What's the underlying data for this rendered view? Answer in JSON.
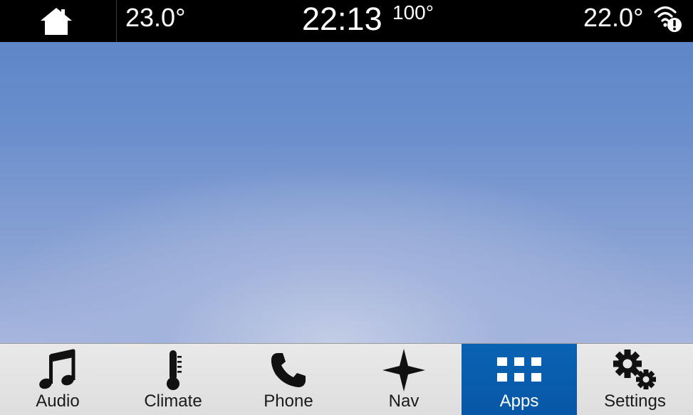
{
  "status_bar": {
    "driver_temp": "23.0°",
    "clock": "22:13",
    "outside_temp": "100°",
    "passenger_temp": "22.0°"
  },
  "nav": {
    "items": [
      {
        "label": "Audio",
        "icon": "music-note-icon",
        "active": false
      },
      {
        "label": "Climate",
        "icon": "thermometer-icon",
        "active": false
      },
      {
        "label": "Phone",
        "icon": "phone-icon",
        "active": false
      },
      {
        "label": "Nav",
        "icon": "compass-star-icon",
        "active": false
      },
      {
        "label": "Apps",
        "icon": "apps-grid-icon",
        "active": true
      },
      {
        "label": "Settings",
        "icon": "gears-icon",
        "active": false
      }
    ]
  },
  "colors": {
    "active_tab": "#0a62b3",
    "status_bar": "#000000",
    "nav_bar": "#e4e4e4"
  }
}
